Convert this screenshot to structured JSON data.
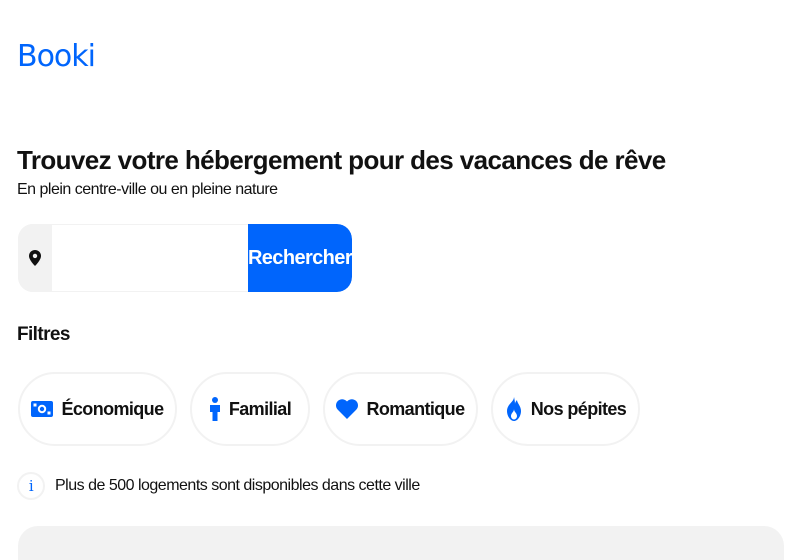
{
  "header": {
    "logo": "Booki"
  },
  "hero": {
    "title": "Trouvez votre hébergement pour des vacances de rêve",
    "subtitle": "En plein centre-ville ou en pleine nature"
  },
  "search": {
    "icon": "map-pin-icon",
    "value": "",
    "button_label": "Rechercher"
  },
  "filters": {
    "title": "Filtres",
    "items": [
      {
        "label": "Économique",
        "icon": "money-bill-icon"
      },
      {
        "label": "Familial",
        "icon": "person-icon"
      },
      {
        "label": "Romantique",
        "icon": "heart-icon"
      },
      {
        "label": "Nos pépites",
        "icon": "fire-icon"
      }
    ]
  },
  "info": {
    "icon": "info-icon",
    "text": "Plus de 500 logements sont disponibles dans cette ville"
  },
  "colors": {
    "brand": "#0065FC",
    "surface": "#F2F2F2"
  }
}
